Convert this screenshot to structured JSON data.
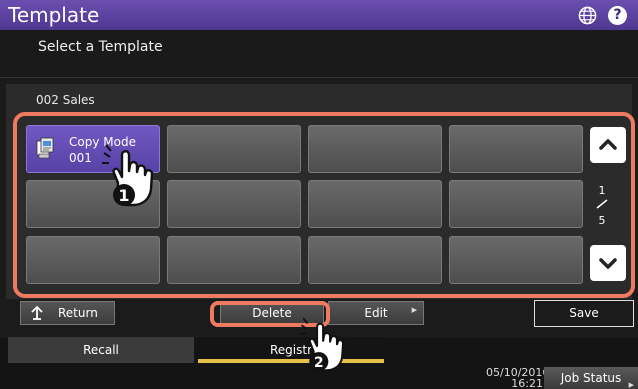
{
  "header": {
    "title": "Template",
    "globe_icon": "globe-icon",
    "help_label": "?"
  },
  "subheader": {
    "instruction": "Select a Template"
  },
  "group": {
    "label": "002 Sales"
  },
  "templates": [
    {
      "name": "Copy Mode",
      "number": "001",
      "icon": "copy-mode-icon"
    }
  ],
  "pager": {
    "current": "1",
    "total": "5",
    "up_icon": "chevron-up-icon",
    "down_icon": "chevron-down-icon"
  },
  "toolbar": {
    "return_label": "Return",
    "delete_label": "Delete",
    "edit_label": "Edit",
    "save_label": "Save"
  },
  "tabs": {
    "recall_label": "Recall",
    "registration_label": "Registr"
  },
  "status": {
    "date": "05/10/2016",
    "time": "16:21",
    "job_status_label": "Job Status"
  },
  "callouts": {
    "step1": "1",
    "step2": "2"
  },
  "colors": {
    "accent_purple": "#5742a6",
    "callout_orange": "#ee7a62",
    "tab_underline": "#e6c14a"
  }
}
